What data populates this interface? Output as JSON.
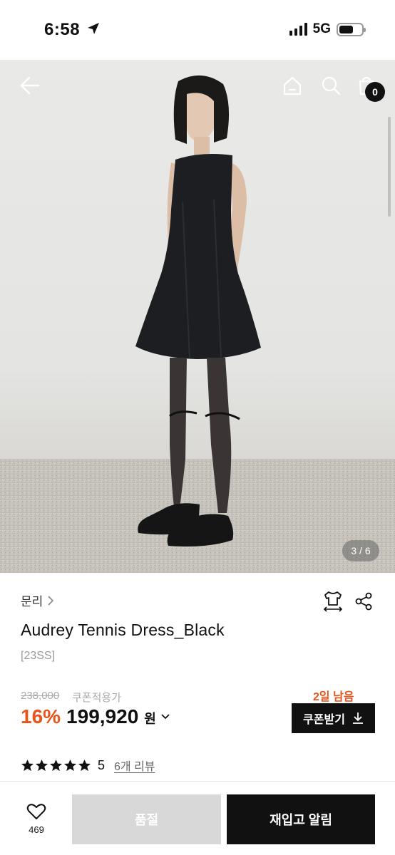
{
  "status_bar": {
    "time": "6:58",
    "network": "5G"
  },
  "gallery": {
    "page_indicator": "3 / 6",
    "cart_count": "0"
  },
  "product": {
    "brand": "문리",
    "title": "Audrey Tennis Dress_Black",
    "season": "[23SS]",
    "original_price": "238,000",
    "coupon_note": "쿠폰적용가",
    "days_left": "2일 남음",
    "discount": "16%",
    "price": "199,920",
    "currency": "원",
    "coupon_button": "쿠폰받기",
    "rating": {
      "stars": 5,
      "value": "5",
      "reviews": "6개 리뷰"
    }
  },
  "bottom_bar": {
    "like_count": "469",
    "soldout_label": "품절",
    "restock_label": "재입고 알림"
  },
  "colors": {
    "accent": "#e8541a",
    "primary": "#111111",
    "disabled": "#d8d8d8"
  },
  "icons": [
    "location-arrow-icon",
    "signal-icon",
    "battery-icon",
    "back-arrow-icon",
    "home-icon",
    "search-icon",
    "shopping-bag-icon",
    "chevron-right-icon",
    "size-fit-icon",
    "share-icon",
    "chevron-down-icon",
    "download-icon",
    "star-icon",
    "heart-icon"
  ]
}
